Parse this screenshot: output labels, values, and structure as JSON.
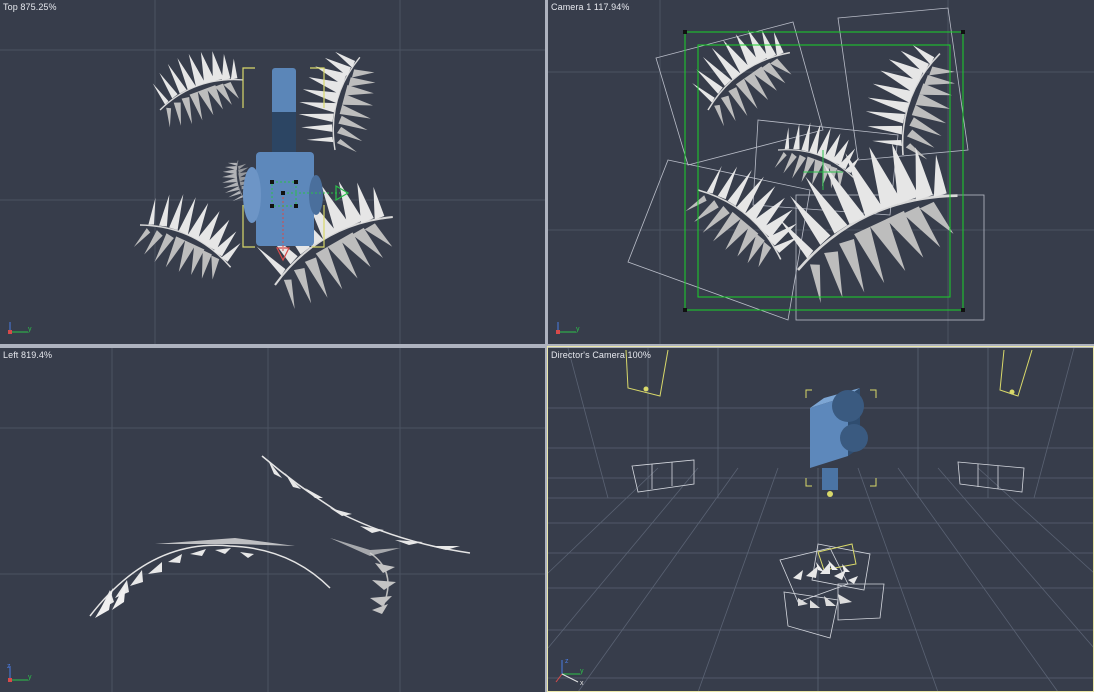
{
  "viewports": {
    "top": {
      "label": "Top 875.25%"
    },
    "camera1": {
      "label": "Camera 1 117.94%"
    },
    "left": {
      "label": "Left 819.4%"
    },
    "director": {
      "label": "Director's Camera 100%"
    }
  },
  "colors": {
    "background": "#373d4b",
    "grid": "#4d5464",
    "frond": "#e4e4e4",
    "camera_body": "#5d88bb",
    "camera_frame": "#18d22a",
    "selection_bracket": "#d9d96a",
    "wire": "#b9bdc8",
    "active_viewport": "#e9e6a8"
  },
  "icons": [
    "axis-gizmo-icon",
    "move-gizmo-icon",
    "camera-model-icon",
    "spotlight-icon"
  ]
}
